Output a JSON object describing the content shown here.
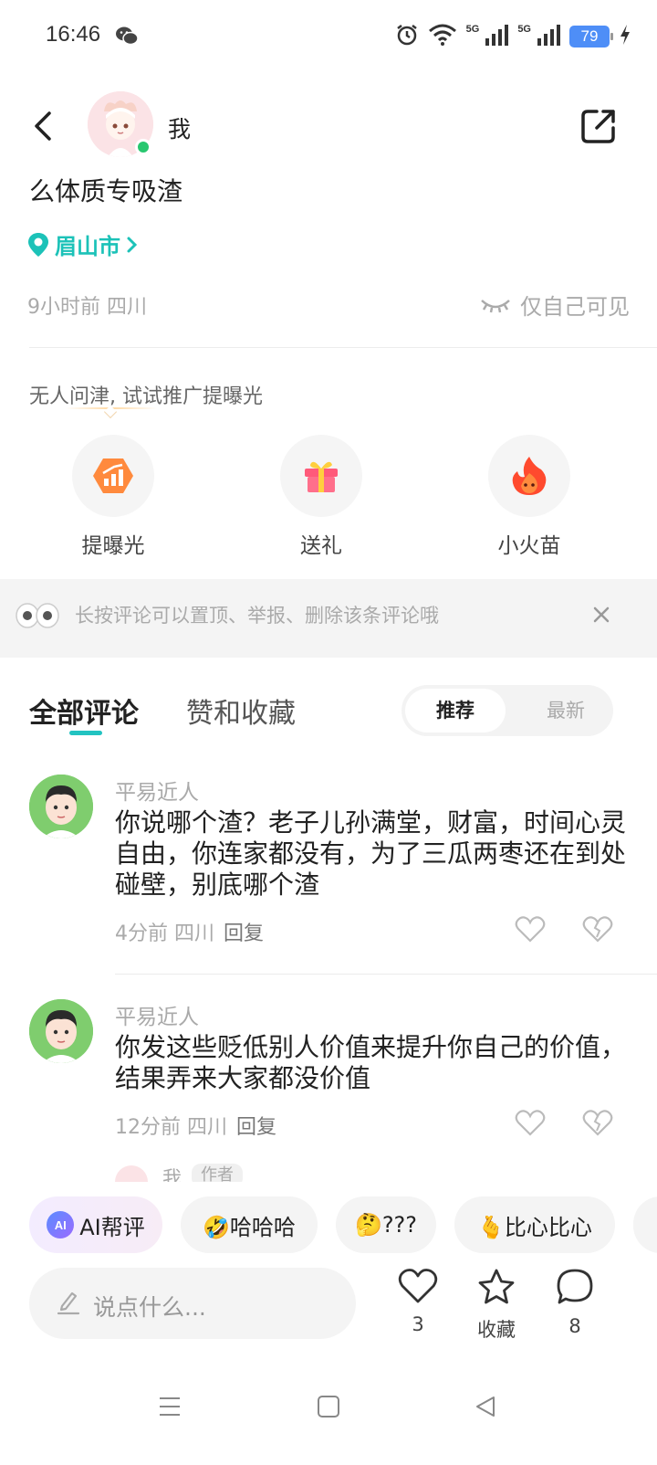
{
  "status_bar": {
    "time": "16:46",
    "battery": "79",
    "network_1": "5G",
    "network_2": "5G"
  },
  "header": {
    "name": "我"
  },
  "post": {
    "text": "么体质专吸渣",
    "location": "眉山市",
    "time_place": "9小时前 四川",
    "visibility": "仅自己可见"
  },
  "promo": {
    "hint": "无人问津, 试试推广提曝光",
    "items": [
      {
        "label": "提曝光",
        "icon": "boost-icon"
      },
      {
        "label": "送礼",
        "icon": "gift-icon"
      },
      {
        "label": "小火苗",
        "icon": "flame-icon"
      }
    ]
  },
  "tip": {
    "text": "长按评论可以置顶、举报、删除该条评论哦"
  },
  "tabs": {
    "all_comments": "全部评论",
    "likes_favorites": "赞和收藏",
    "sort_recommended": "推荐",
    "sort_latest": "最新"
  },
  "comments": [
    {
      "name": "平易近人",
      "text": "你说哪个渣？老子儿孙满堂，财富，时间心灵自由，你连家都没有，为了三瓜两枣还在到处碰壁，别底哪个渣",
      "time_place": "4分前 四川",
      "reply": "回复"
    },
    {
      "name": "平易近人",
      "text": "你发这些贬低别人价值来提升你自己的价值，结果弄来大家都没价值",
      "time_place": "12分前 四川",
      "reply": "回复"
    }
  ],
  "peek_comment": {
    "name": "我",
    "badge": "作者"
  },
  "quick_replies": {
    "ai_label": "AI帮评",
    "ai_logo": "AI",
    "chip1": "🤣哈哈哈",
    "chip2": "🤔???",
    "chip3": "🫰比心比心"
  },
  "bottom": {
    "placeholder": "说点什么...",
    "like_count": "3",
    "favorite_label": "收藏",
    "comment_count": "8"
  },
  "colors": {
    "accent": "#22c3c1",
    "location": "#1cc2b8",
    "online": "#28c76f"
  }
}
